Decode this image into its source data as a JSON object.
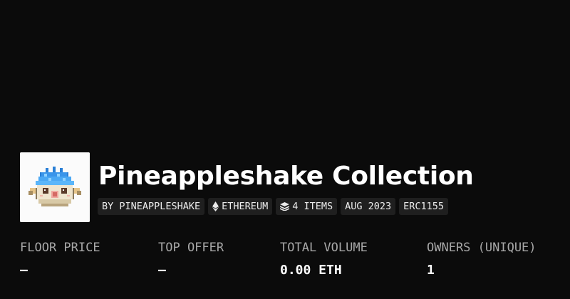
{
  "collection": {
    "title": "Pineappleshake Collection",
    "avatar_icon": "pixel-pufferfish-avatar"
  },
  "tags": [
    {
      "label": "BY PINEAPPLESHAKE",
      "icon": null
    },
    {
      "label": "ETHEREUM",
      "icon": "ethereum-icon"
    },
    {
      "label": "4 ITEMS",
      "icon": "layers-icon"
    },
    {
      "label": "AUG 2023",
      "icon": null
    },
    {
      "label": "ERC1155",
      "icon": null
    }
  ],
  "stats": [
    {
      "label": "FLOOR PRICE",
      "value": "—"
    },
    {
      "label": "TOP OFFER",
      "value": "—"
    },
    {
      "label": "TOTAL VOLUME",
      "value": "0.00 ETH"
    },
    {
      "label": "OWNERS (UNIQUE)",
      "value": "1"
    }
  ],
  "colors": {
    "background": "#0b0b0b",
    "tag_background": "#1f1f1f",
    "label_gray": "#a8a8a8",
    "text_white": "#ffffff"
  }
}
